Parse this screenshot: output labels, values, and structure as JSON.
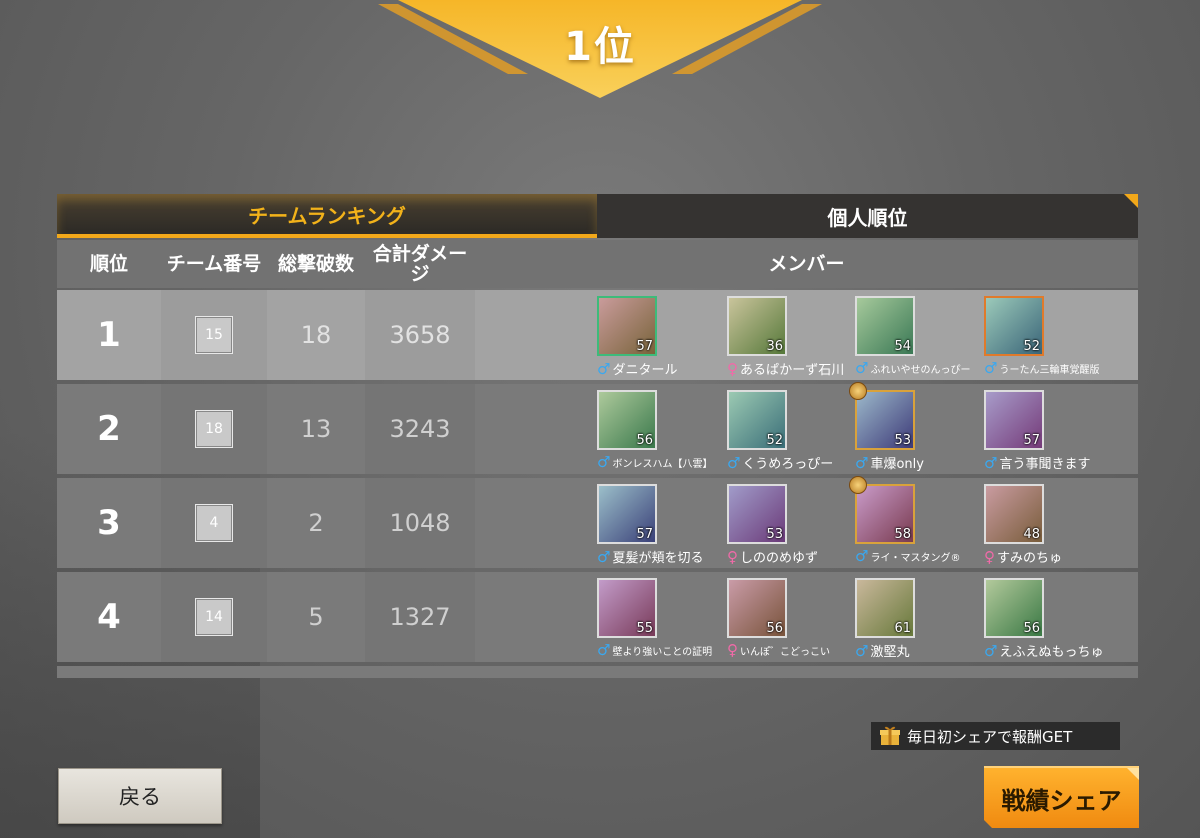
{
  "banner": {
    "rank_label": "1位"
  },
  "tabs": [
    {
      "label": "チームランキング",
      "active": true
    },
    {
      "label": "個人順位",
      "active": false
    }
  ],
  "table": {
    "headers": {
      "rank": "順位",
      "team_no": "チーム番号",
      "kills": "総撃破数",
      "damage": "合計ダメージ",
      "members": "メンバー"
    },
    "rows": [
      {
        "rank": "1",
        "team_no": "15",
        "kills": "18",
        "damage": "3658",
        "members": [
          {
            "name": "ダニタール",
            "gender": "♂",
            "level": "57",
            "frame": "green"
          },
          {
            "name": "あるぱかーず石川",
            "gender": "♀",
            "level": "36",
            "frame": "plain"
          },
          {
            "name": "ふれいやせのんっぴー",
            "gender": "♂",
            "level": "54",
            "frame": "plain"
          },
          {
            "name": "うーたん三輪車覚醒版",
            "gender": "♂",
            "level": "52",
            "frame": "orange"
          }
        ]
      },
      {
        "rank": "2",
        "team_no": "18",
        "kills": "13",
        "damage": "3243",
        "members": [
          {
            "name": "ボンレスハム【八雲】",
            "gender": "♂",
            "level": "56",
            "frame": "plain"
          },
          {
            "name": "くうめろっぴー",
            "gender": "♂",
            "level": "52",
            "frame": "plain"
          },
          {
            "name": "車爆only",
            "gender": "♂",
            "level": "53",
            "frame": "gold"
          },
          {
            "name": "言う事聞きます",
            "gender": "♂",
            "level": "57",
            "frame": "plain"
          }
        ]
      },
      {
        "rank": "3",
        "team_no": "4",
        "kills": "2",
        "damage": "1048",
        "members": [
          {
            "name": "夏髪が頬を切る",
            "gender": "♂",
            "level": "57",
            "frame": "plain"
          },
          {
            "name": "しののめゆず",
            "gender": "♀",
            "level": "53",
            "frame": "plain"
          },
          {
            "name": "ライ・マスタング®",
            "gender": "♂",
            "level": "58",
            "frame": "gold"
          },
          {
            "name": "すみのちゅ",
            "gender": "♀",
            "level": "48",
            "frame": "plain"
          }
        ]
      },
      {
        "rank": "4",
        "team_no": "14",
        "kills": "5",
        "damage": "1327",
        "members": [
          {
            "name": "壁より強いことの証明",
            "gender": "♂",
            "level": "55",
            "frame": "plain"
          },
          {
            "name": "いんぽ゛こどっこい",
            "gender": "♀",
            "level": "56",
            "frame": "plain"
          },
          {
            "name": "激堅丸",
            "gender": "♂",
            "level": "61",
            "frame": "plain"
          },
          {
            "name": "えふえぬもっちゅ",
            "gender": "♂",
            "level": "56",
            "frame": "plain"
          }
        ]
      }
    ]
  },
  "buttons": {
    "back": "戻る",
    "share": "戦績シェア",
    "share_hint": "毎日初シェアで報酬GET"
  },
  "colors": {
    "accent": "#f2a81a",
    "male": "#3aa8f0",
    "female": "#f06aa8"
  },
  "icons": {
    "gift": "gift-icon",
    "medal": "medal-icon"
  }
}
